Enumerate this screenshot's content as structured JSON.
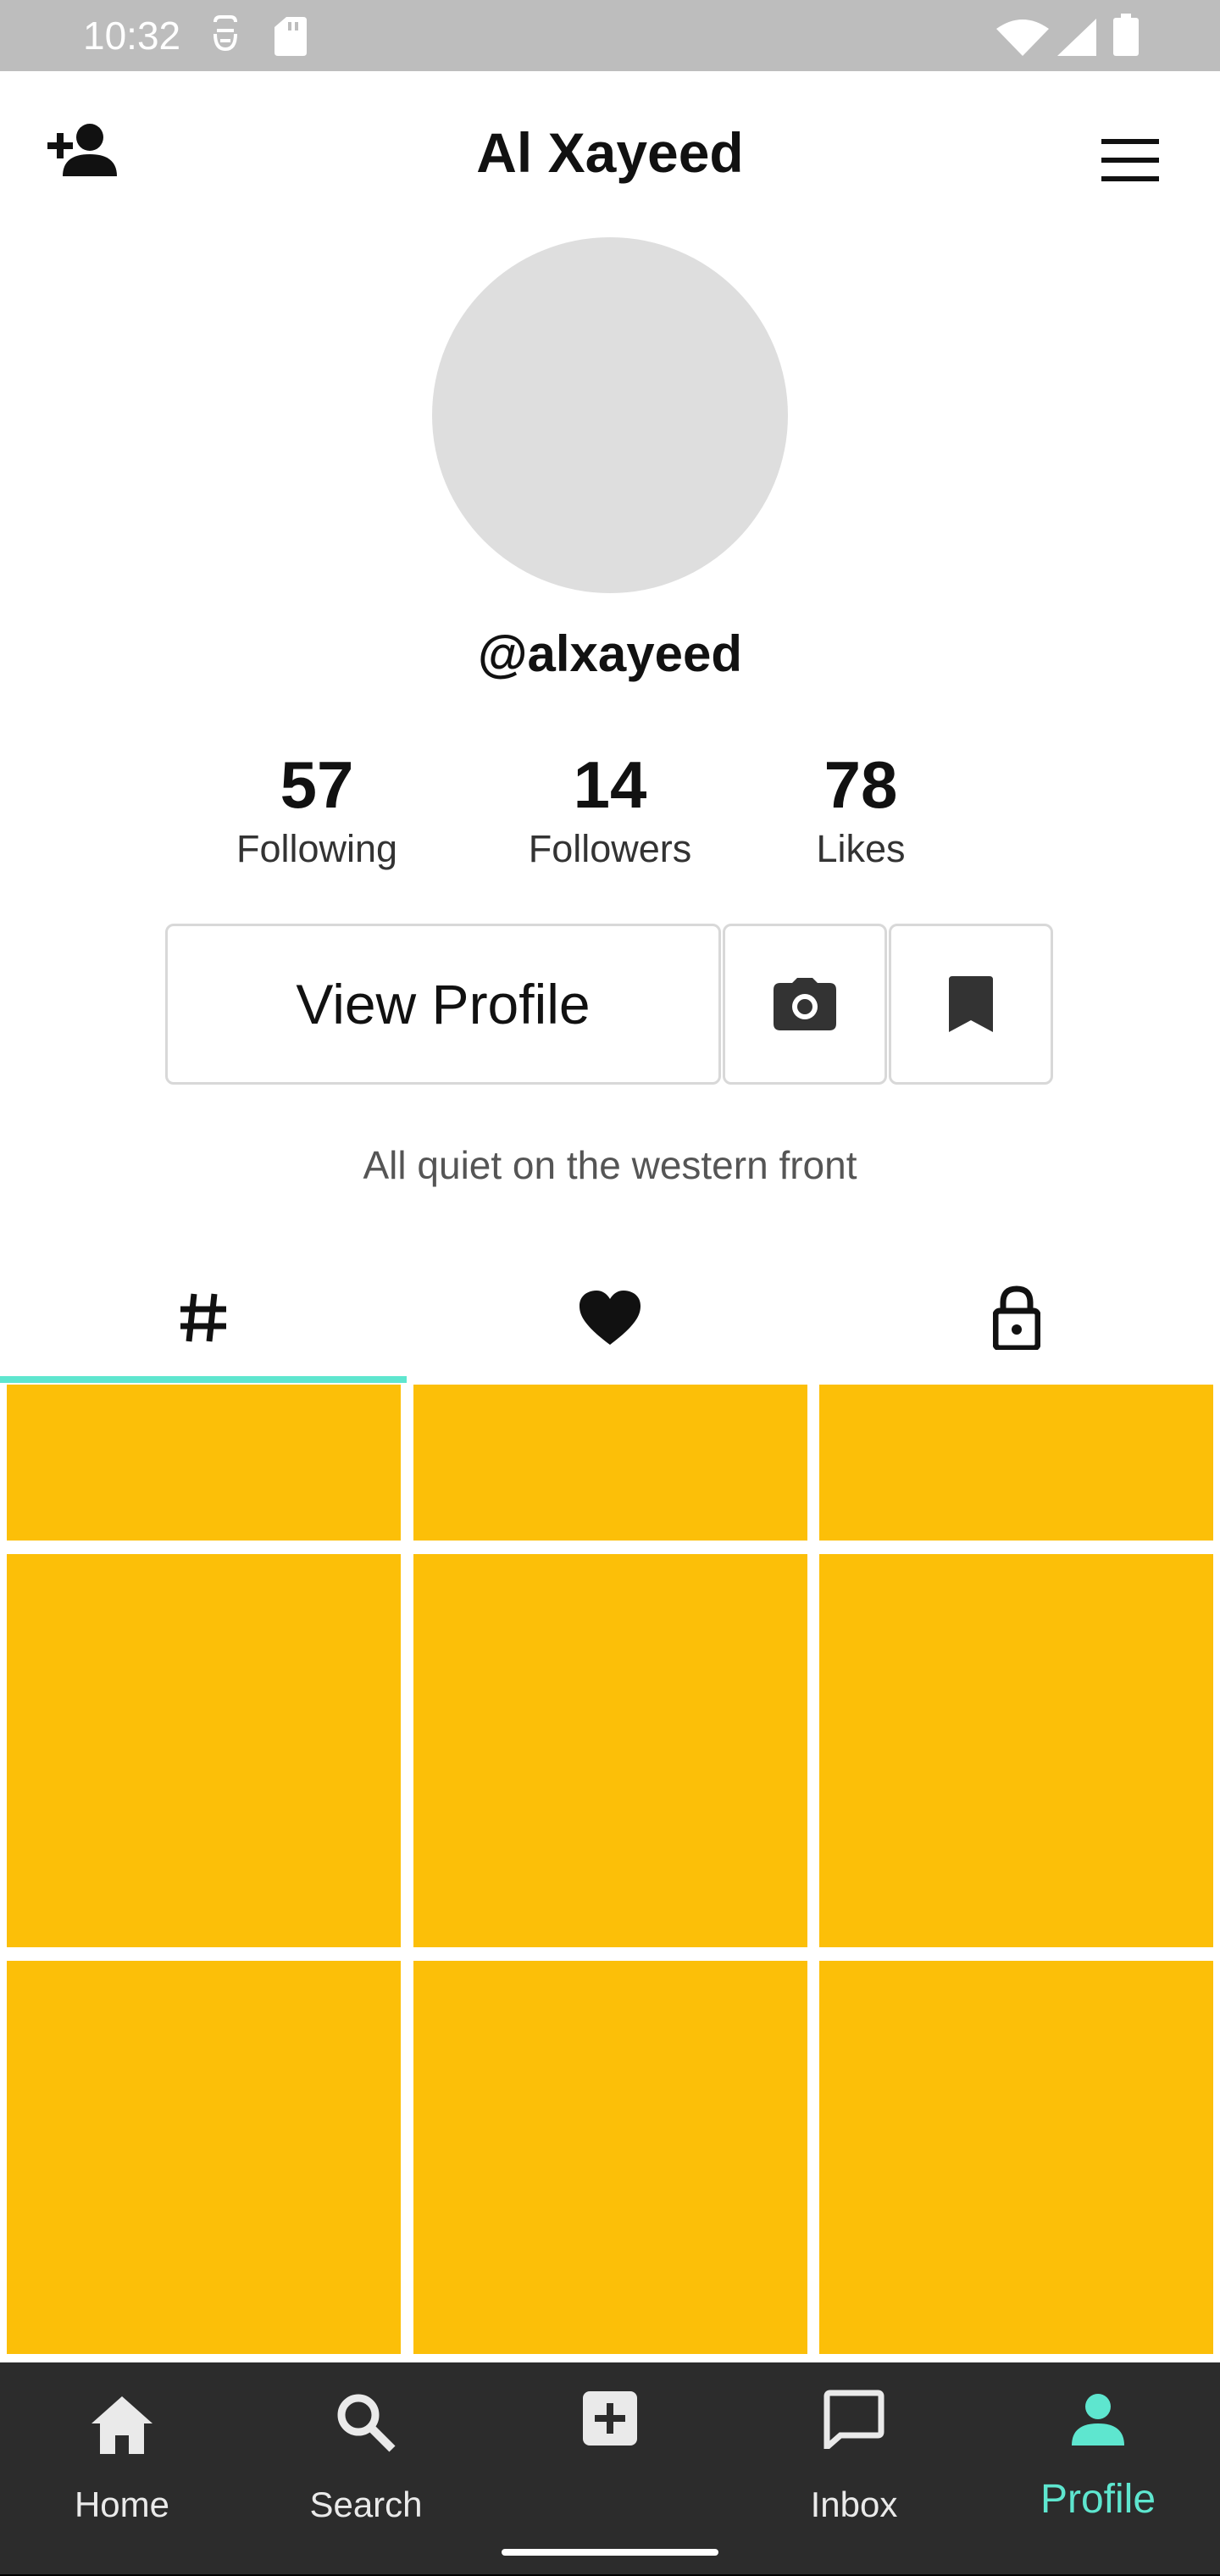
{
  "status_bar": {
    "time": "10:32"
  },
  "header": {
    "title": "Al Xayeed"
  },
  "profile": {
    "handle": "@alxayeed",
    "bio": "All quiet on the western front",
    "stats": [
      {
        "value": "57",
        "label": "Following"
      },
      {
        "value": "14",
        "label": "Followers"
      },
      {
        "value": "78",
        "label": "Likes"
      }
    ],
    "view_profile_label": "View Profile"
  },
  "tabs": [
    {
      "icon": "hashtag-icon",
      "active": true
    },
    {
      "icon": "heart-icon",
      "active": false
    },
    {
      "icon": "lock-icon",
      "active": false
    }
  ],
  "video_grid": {
    "tile_count": 9
  },
  "bottom_nav": [
    {
      "label": "Home",
      "icon": "home-icon",
      "active": false
    },
    {
      "label": "Search",
      "icon": "search-icon",
      "active": false
    },
    {
      "label": "",
      "icon": "add-icon",
      "active": false
    },
    {
      "label": "Inbox",
      "icon": "inbox-icon",
      "active": false
    },
    {
      "label": "Profile",
      "icon": "profile-icon",
      "active": true
    }
  ],
  "colors": {
    "accent": "#5ee6cf",
    "tile": "#fcbf08",
    "avatar_placeholder": "#dedede",
    "nav_background": "#2c2c2c"
  }
}
